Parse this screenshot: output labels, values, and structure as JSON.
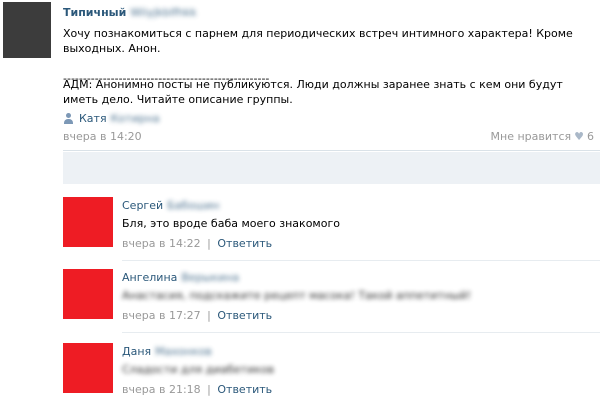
{
  "post": {
    "author_name": "Типичный",
    "author_suffix": "Wiiyjkblfhkk",
    "text": "Хочу познакомиться с парнем для периодических встреч интимного характера! Кроме выходных. Анон.",
    "separator": "----------------------------------------------------",
    "adm_text": "АДМ: Анонимно посты не публикуются. Люди должны заранее знать с кем они будут иметь дело. Читайте описание группы.",
    "signer_first": "Катя",
    "signer_last": "Котирна",
    "time": "вчера в 14:20",
    "time_icon": "apple-icon",
    "like_label": "Мне нравится",
    "like_icon": "heart-icon",
    "like_count": "6"
  },
  "comments": [
    {
      "first": "Сергей",
      "last": "Бабошин",
      "text": "Бля, это вроде баба моего знакомого",
      "time": "вчера в 14:22",
      "sep": "|",
      "reply": "Ответить"
    },
    {
      "first": "Ангелина",
      "last": "Верыкина",
      "text": "Анастасия, подскажите рецепт масока! Такой аппетитный!",
      "time": "вчера в 17:27",
      "sep": "|",
      "reply": "Ответить"
    },
    {
      "first": "Даня",
      "last": "Махонков",
      "text": "Сладости для диабетиков",
      "time": "вчера в 21:18",
      "sep": "|",
      "reply": "Ответить"
    }
  ],
  "colors": {
    "link": "#2b587a",
    "meta": "#999999",
    "avatar_post": "#3c3c3c",
    "avatar_comment": "#ee1c24",
    "comment_box": "#edf1f5"
  }
}
